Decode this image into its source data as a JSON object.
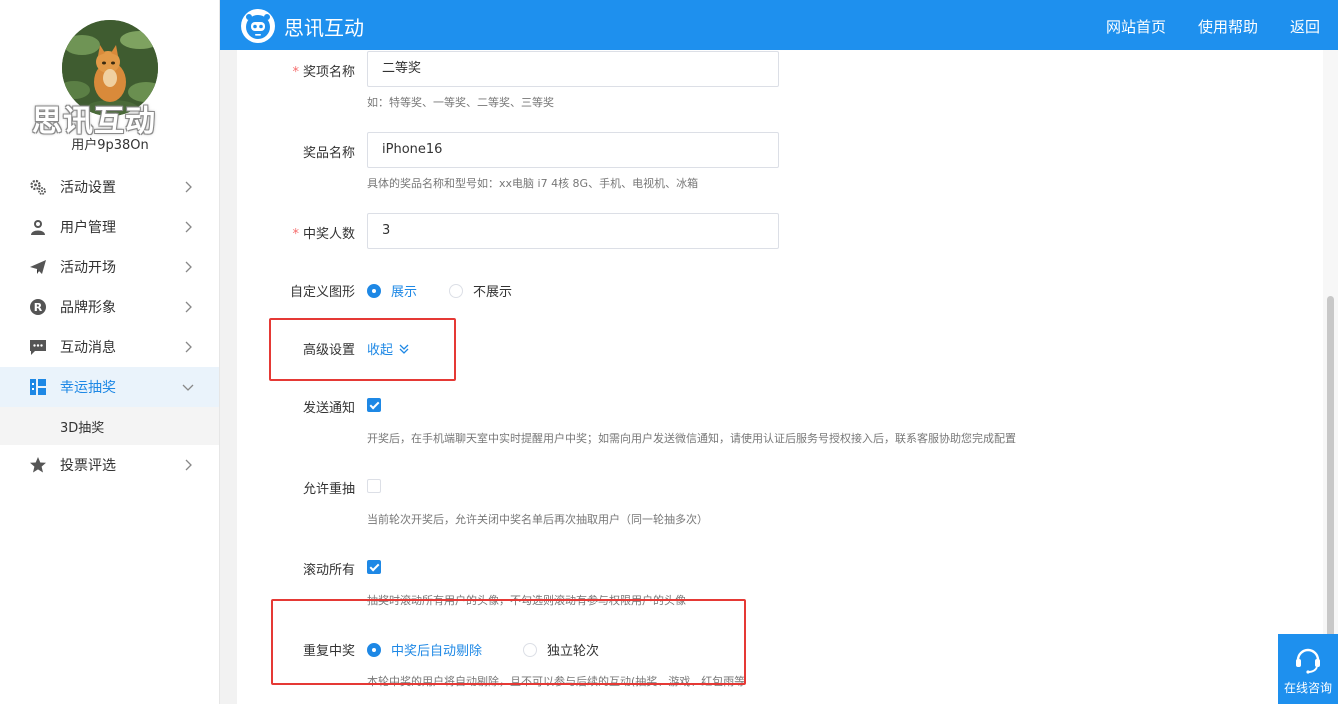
{
  "header": {
    "title": "思讯互动",
    "nav": [
      "网站首页",
      "使用帮助",
      "返回"
    ]
  },
  "sidebar": {
    "brand": "思讯互动",
    "username": "用户9p38On",
    "menu": [
      {
        "label": "活动设置",
        "icon": "gears-icon"
      },
      {
        "label": "用户管理",
        "icon": "user-icon"
      },
      {
        "label": "活动开场",
        "icon": "paper-plane-icon"
      },
      {
        "label": "品牌形象",
        "icon": "registered-icon"
      },
      {
        "label": "互动消息",
        "icon": "message-icon"
      },
      {
        "label": "幸运抽奖",
        "icon": "lottery-icon"
      },
      {
        "label": "投票评选",
        "icon": "star-icon"
      }
    ],
    "submenu": {
      "label": "3D抽奖"
    }
  },
  "form": {
    "prize_level": {
      "label": "奖项名称",
      "value": "二等奖",
      "help": "如：特等奖、一等奖、二等奖、三等奖"
    },
    "prize_name": {
      "label": "奖品名称",
      "value": "iPhone16",
      "help": "具体的奖品名称和型号如：xx电脑 i7 4核 8G、手机、电视机、冰箱"
    },
    "winners": {
      "label": "中奖人数",
      "value": "3"
    },
    "custom_shape": {
      "label": "自定义图形",
      "options": [
        "展示",
        "不展示"
      ],
      "selected": "展示"
    },
    "advanced": {
      "label": "高级设置",
      "toggle": "收起"
    },
    "send_notice": {
      "label": "发送通知",
      "checked": true,
      "help": "开奖后，在手机端聊天室中实时提醒用户中奖；如需向用户发送微信通知，请使用认证后服务号授权接入后，联系客服协助您完成配置"
    },
    "allow_redraw": {
      "label": "允许重抽",
      "checked": false,
      "help": "当前轮次开奖后，允许关闭中奖名单后再次抽取用户（同一轮抽多次）"
    },
    "scroll_all": {
      "label": "滚动所有",
      "checked": true,
      "help": "抽奖时滚动所有用户的头像，不勾选则滚动有参与权限用户的头像"
    },
    "repeat_win": {
      "label": "重复中奖",
      "options": [
        "中奖后自动剔除",
        "独立轮次"
      ],
      "selected": "中奖后自动剔除",
      "help": "本轮中奖的用户将自动剔除，且不可以参与后续的互动(抽奖、游戏、红包雨等"
    }
  },
  "consult": {
    "label": "在线咨询"
  },
  "colors": {
    "primary": "#1e90ee",
    "highlight": "#e53935",
    "required": "#f56c6c"
  }
}
